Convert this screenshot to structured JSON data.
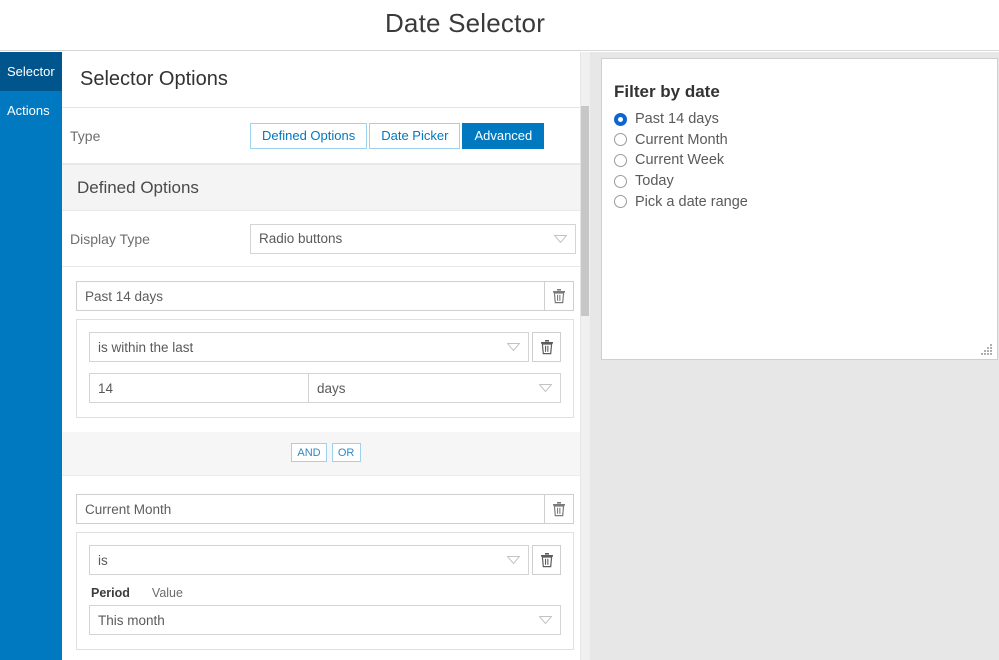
{
  "topbar": {
    "title": "Date Selector"
  },
  "sidebar": {
    "items": [
      {
        "label": "Selector",
        "active": true
      },
      {
        "label": "Actions",
        "active": false
      }
    ]
  },
  "options_panel": {
    "header": "Selector Options",
    "type_row": {
      "label": "Type",
      "buttons": [
        {
          "label": "Defined Options",
          "active": false
        },
        {
          "label": "Date Picker",
          "active": false
        },
        {
          "label": "Advanced",
          "active": true
        }
      ]
    },
    "section_title": "Defined Options",
    "display_type": {
      "label": "Display Type",
      "value": "Radio buttons"
    },
    "groups": [
      {
        "name": "Past 14 days",
        "delete_icon": "trash-icon",
        "operator": "is within the last",
        "operator_delete_icon": "trash-icon",
        "amount": "14",
        "unit": "days",
        "logic_buttons": [
          "AND",
          "OR"
        ]
      },
      {
        "name": "Current Month",
        "delete_icon": "trash-icon",
        "operator": "is",
        "operator_delete_icon": "trash-icon",
        "period_label": "Period",
        "value_label": "Value",
        "period_value": "This month"
      }
    ]
  },
  "preview": {
    "title": "Filter by date",
    "options": [
      {
        "label": "Past 14 days",
        "selected": true
      },
      {
        "label": "Current Month",
        "selected": false
      },
      {
        "label": "Current Week",
        "selected": false
      },
      {
        "label": "Today",
        "selected": false
      },
      {
        "label": "Pick a date range",
        "selected": false
      }
    ],
    "resize_grip_icon": "resize-grip-icon"
  },
  "colors": {
    "accent_blue": "#0079c1",
    "active_nav": "#00558c",
    "radio_blue": "#0d66d0",
    "panel_bg": "#e7e7e7"
  }
}
